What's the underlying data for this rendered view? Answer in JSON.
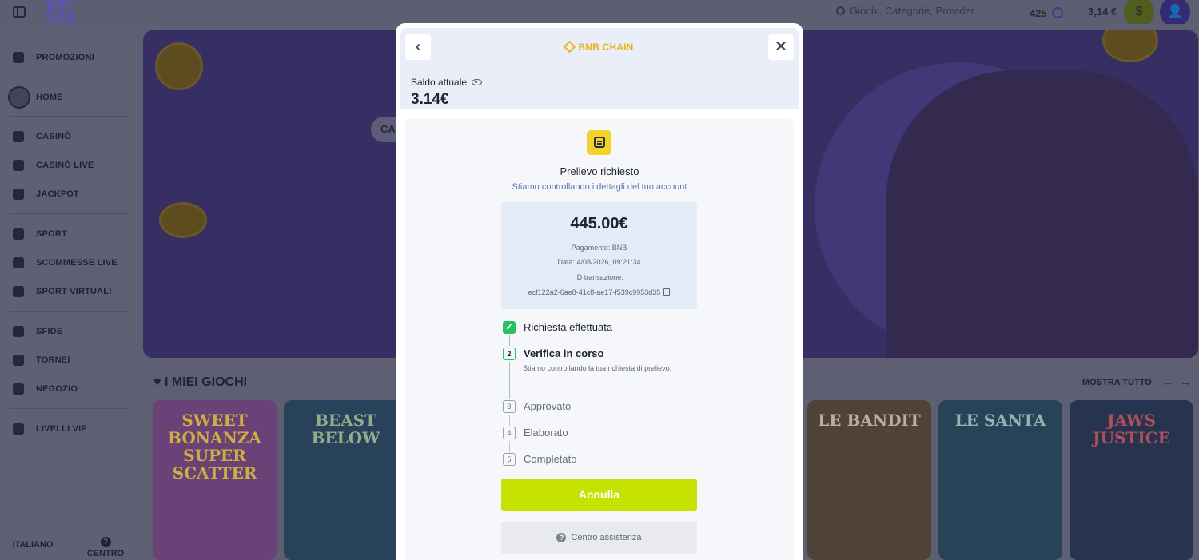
{
  "topbar": {
    "logo_top": "VIP",
    "logo_bottom": "STA",
    "search_placeholder": "Giochi, Categorie, Provider",
    "coins": "425",
    "balance": "3,14 €"
  },
  "sidebar": {
    "items": [
      {
        "label": "PROMOZIONI",
        "icon": "gift-icon"
      },
      {
        "label": "HOME",
        "icon": "house-icon"
      },
      {
        "label": "CASINÒ",
        "icon": "cards-icon"
      },
      {
        "label": "CASINÒ LIVE",
        "icon": "live-casino-icon"
      },
      {
        "label": "JACKPOT",
        "icon": "jackpot-icon"
      },
      {
        "label": "SPORT",
        "icon": "ball-icon"
      },
      {
        "label": "SCOMMESSE LIVE",
        "icon": "play-icon"
      },
      {
        "label": "SPORT VIRTUALI",
        "icon": "gamepad-icon"
      },
      {
        "label": "SFIDE",
        "icon": "challenge-icon"
      },
      {
        "label": "TORNEI",
        "icon": "trophy-icon"
      },
      {
        "label": "NEGOZIO",
        "icon": "shop-icon"
      },
      {
        "label": "LIVELLI VIP",
        "icon": "crown-icon"
      }
    ],
    "language": "ITALIANO",
    "help": "CENTRO"
  },
  "banner": {
    "pill": "CA"
  },
  "games": {
    "title": "I MIEI GIOCHI",
    "show_all": "MOSTRA TUTTO",
    "cards": [
      {
        "name": "SWEET BONANZA SUPER SCATTER"
      },
      {
        "name": "BEAST BELOW"
      },
      {
        "name": "LE BANDIT"
      },
      {
        "name": "LE SANTA"
      },
      {
        "name": "JAWS JUSTICE"
      }
    ]
  },
  "modal": {
    "chain": "BNB CHAIN",
    "balance_label": "Saldo attuale",
    "balance_value": "3.14€",
    "status_title": "Prelievo richiesto",
    "status_subtitle": "Stiamo controllando i dettagli del tuo account",
    "amount": "445.00€",
    "payment": "Pagamento: BNB",
    "date": "Data: 4/08/2026, 09:21:34",
    "tx_label": "ID transazione:",
    "tx_id": "ecf122a2-6ae8-41c8-ae17-f539c9953d35",
    "steps": [
      {
        "num": "✓",
        "label": "Richiesta effettuata",
        "state": "done"
      },
      {
        "num": "2",
        "label": "Verifica in corso",
        "state": "current"
      },
      {
        "num": "3",
        "label": "Approvato",
        "state": "pending"
      },
      {
        "num": "4",
        "label": "Elaborato",
        "state": "pending"
      },
      {
        "num": "5",
        "label": "Completato",
        "state": "pending"
      }
    ],
    "current_note": "Stiamo controllando la tua richiesta di prelievo.",
    "cancel": "Annulla",
    "help": "Centro assistenza"
  }
}
